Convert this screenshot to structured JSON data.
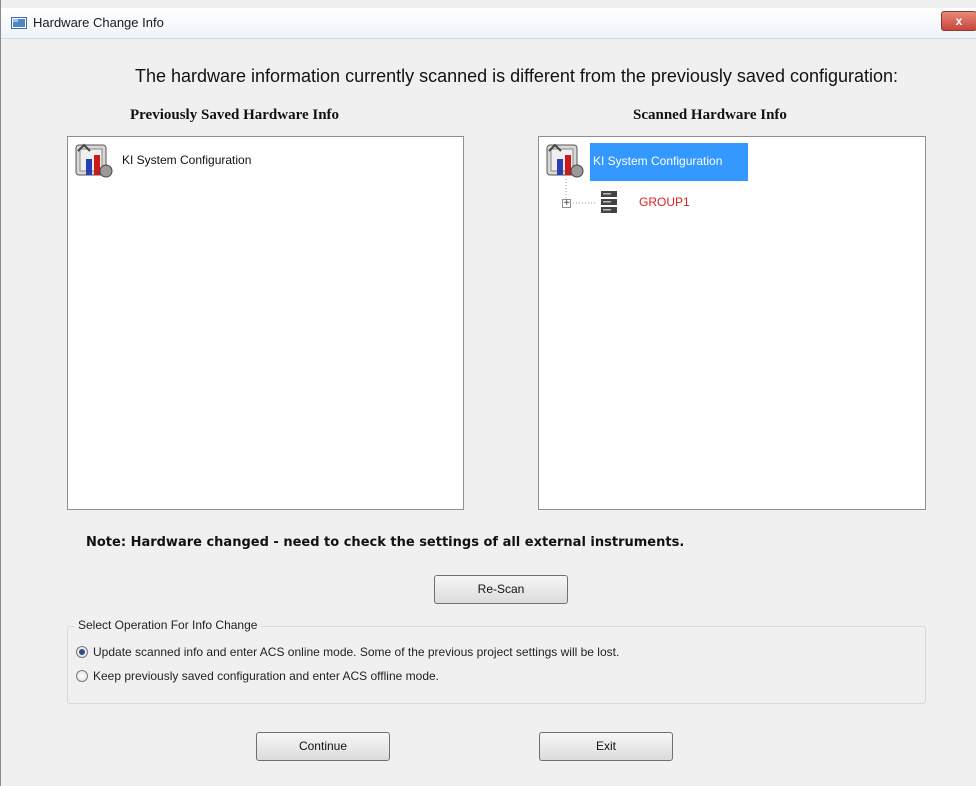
{
  "window": {
    "title": "Hardware Change Info",
    "close_label": "x"
  },
  "heading": "The hardware information currently scanned is different from the previously saved configuration:",
  "left_panel": {
    "title": "Previously Saved Hardware Info",
    "root_label": "KI System Configuration"
  },
  "right_panel": {
    "title": "Scanned Hardware Info",
    "root_label": "KI System Configuration",
    "child_label": "GROUP1",
    "child_color": "#e02020",
    "selection_color": "#3399ff"
  },
  "note": "Note: Hardware changed - need to check the settings of all external instruments.",
  "buttons": {
    "rescan": "Re-Scan",
    "continue": "Continue",
    "exit": "Exit"
  },
  "operation": {
    "legend": "Select Operation For Info Change",
    "options": [
      {
        "label": "Update scanned info and enter ACS online mode. Some of the previous project settings will be lost.",
        "selected": true
      },
      {
        "label": "Keep previously saved configuration and enter ACS offline mode.",
        "selected": false
      }
    ]
  }
}
